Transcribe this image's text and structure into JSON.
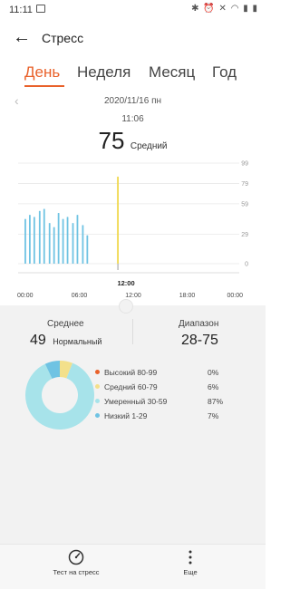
{
  "status_bar": {
    "time": "11:11",
    "right_icons": "bluetooth alarm mute wifi signal battery"
  },
  "header": {
    "back_icon": "arrow-left",
    "title": "Стресс"
  },
  "tabs": [
    {
      "label": "День",
      "active": true
    },
    {
      "label": "Неделя",
      "active": false
    },
    {
      "label": "Месяц",
      "active": false
    },
    {
      "label": "Год",
      "active": false
    }
  ],
  "date": "2020/11/16 пн",
  "selection": {
    "time": "11:06",
    "value": "75",
    "level": "Средний"
  },
  "colors": {
    "accent": "#e9612a",
    "low": "#6fc3e3",
    "moderate": "#a7e3ea",
    "medium": "#f3e08b",
    "high": "#e9612a",
    "cursor": "#f0d84c"
  },
  "chart_data": {
    "type": "bar",
    "x_ticks": [
      "00:00",
      "06:00",
      "12:00",
      "18:00",
      "00:00"
    ],
    "y_ticks": [
      0,
      29,
      59,
      79,
      99
    ],
    "ylim": [
      0,
      99
    ],
    "xlim_hours": [
      0,
      24
    ],
    "selected_x_hours": 11.1,
    "selected_label": "12:00",
    "bars": [
      {
        "x": 0.8,
        "y": 44
      },
      {
        "x": 1.3,
        "y": 48
      },
      {
        "x": 1.8,
        "y": 46
      },
      {
        "x": 2.4,
        "y": 52
      },
      {
        "x": 2.9,
        "y": 54
      },
      {
        "x": 3.5,
        "y": 40
      },
      {
        "x": 4.0,
        "y": 36
      },
      {
        "x": 4.5,
        "y": 50
      },
      {
        "x": 5.0,
        "y": 44
      },
      {
        "x": 5.5,
        "y": 46
      },
      {
        "x": 6.1,
        "y": 40
      },
      {
        "x": 6.6,
        "y": 48
      },
      {
        "x": 7.2,
        "y": 38
      },
      {
        "x": 7.7,
        "y": 28
      },
      {
        "x": 11.1,
        "y": 75
      }
    ]
  },
  "summary": {
    "average_label": "Среднее",
    "average_value": "49",
    "average_level": "Нормальный",
    "range_label": "Диапазон",
    "range_value": "28-75"
  },
  "distribution": [
    {
      "label": "Высокий 80-99",
      "pct": "0%",
      "value": 0,
      "color": "#e9612a"
    },
    {
      "label": "Средний 60-79",
      "pct": "6%",
      "value": 6,
      "color": "#f3e08b"
    },
    {
      "label": "Умеренный 30-59",
      "pct": "87%",
      "value": 87,
      "color": "#a7e3ea"
    },
    {
      "label": "Низкий 1-29",
      "pct": "7%",
      "value": 7,
      "color": "#6fc3e3"
    }
  ],
  "bottom_bar": [
    {
      "icon": "gauge-icon",
      "label": "Тест на стресс"
    },
    {
      "icon": "more-vertical-icon",
      "label": "Еще"
    }
  ]
}
